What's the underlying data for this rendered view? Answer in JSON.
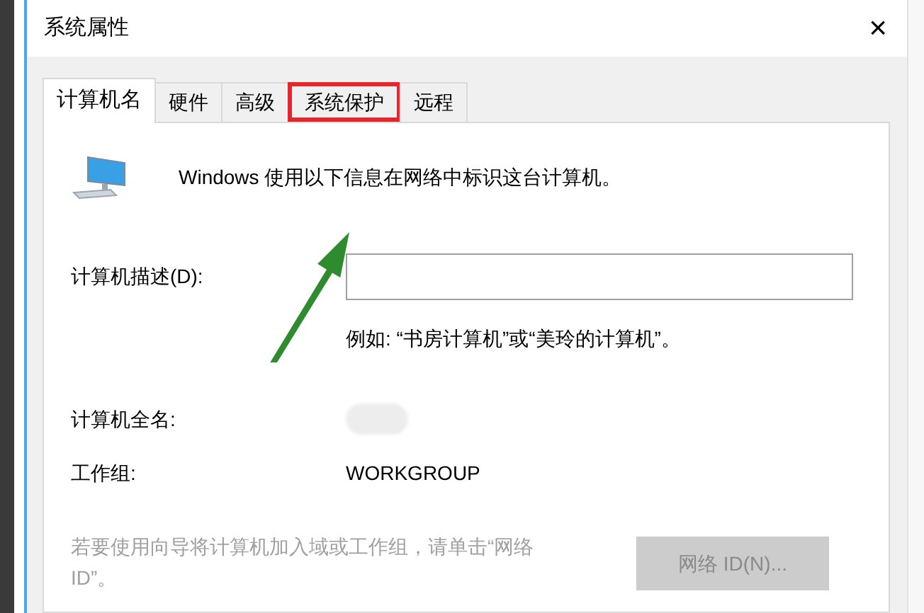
{
  "window": {
    "title": "系统属性",
    "close": "×"
  },
  "tabs": [
    {
      "label": "计算机名",
      "selected": true,
      "highlighted": false
    },
    {
      "label": "硬件",
      "selected": false,
      "highlighted": false
    },
    {
      "label": "高级",
      "selected": false,
      "highlighted": false
    },
    {
      "label": "系统保护",
      "selected": false,
      "highlighted": true
    },
    {
      "label": "远程",
      "selected": false,
      "highlighted": false
    }
  ],
  "intro": "Windows 使用以下信息在网络中标识这台计算机。",
  "description": {
    "label": "计算机描述(D):",
    "example": "例如: “书房计算机”或“美玲的计算机”。"
  },
  "full_name": {
    "label": "计算机全名:"
  },
  "workgroup": {
    "label": "工作组:",
    "value": "WORKGROUP"
  },
  "join_hint": {
    "text": "若要使用向导将计算机加入域或工作组，请单击“网络 ID”。",
    "disabled": true
  },
  "network_button": {
    "label": "网络 ID(N)...",
    "disabled": true
  }
}
